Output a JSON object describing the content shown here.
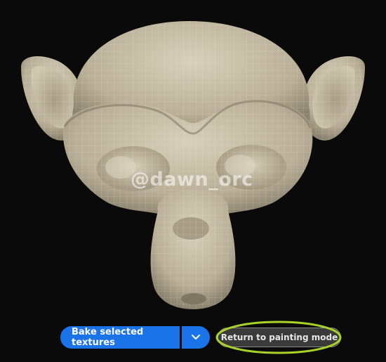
{
  "watermark": "@dawn_orc",
  "toolbar": {
    "bake_label": "Bake selected textures",
    "return_label": "Return to painting mode"
  },
  "icons": {
    "dropdown": "chevron-down-icon"
  },
  "colors": {
    "primary_button": "#1a73e8",
    "highlight_ring": "#a8d22a",
    "background": "#0a0a0a",
    "model_surface": "#c9c0aa"
  }
}
